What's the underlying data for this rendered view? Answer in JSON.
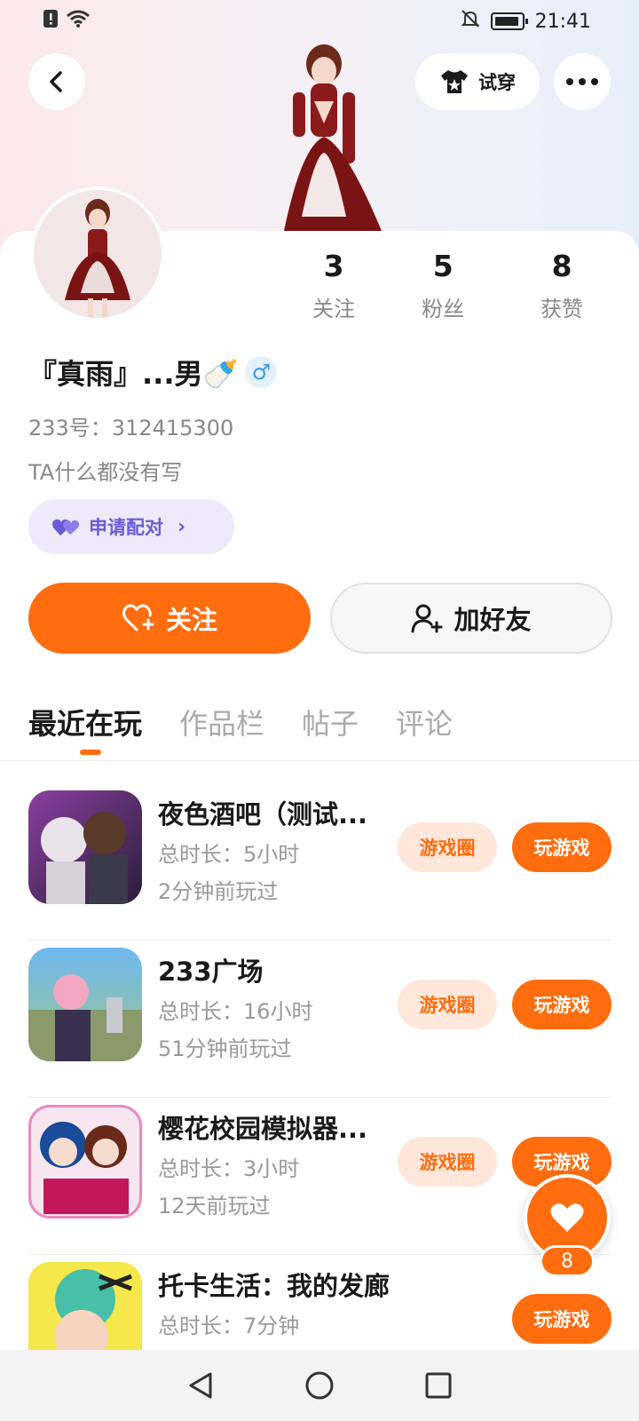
{
  "status_bar": {
    "time": "21:41"
  },
  "header": {
    "tryon_label": "试穿"
  },
  "stats": [
    {
      "value": "3",
      "label": "关注"
    },
    {
      "value": "5",
      "label": "粉丝"
    },
    {
      "value": "8",
      "label": "获赞"
    }
  ],
  "profile": {
    "name": "『真雨』...男🍼",
    "gender_symbol": "♂",
    "uid": "233号：312415300",
    "bio": "TA什么都没有写",
    "pair_label": "申请配对"
  },
  "actions": {
    "follow_label": "关注",
    "add_friend_label": "加好友"
  },
  "tabs": [
    "最近在玩",
    "作品栏",
    "帖子",
    "评论"
  ],
  "games": [
    {
      "title": "夜色酒吧（测试...",
      "duration": "总时长：5小时",
      "last_played": "2分钟前玩过",
      "circle_label": "游戏圈",
      "play_label": "玩游戏"
    },
    {
      "title": "233广场",
      "duration": "总时长：16小时",
      "last_played": "51分钟前玩过",
      "circle_label": "游戏圈",
      "play_label": "玩游戏"
    },
    {
      "title": "樱花校园模拟器...",
      "duration": "总时长：3小时",
      "last_played": "12天前玩过",
      "circle_label": "游戏圈",
      "play_label": "玩游戏"
    },
    {
      "title": "托卡生活：我的发廊",
      "duration": "总时长：7分钟",
      "last_played": "",
      "circle_label": "",
      "play_label": "玩游戏"
    }
  ],
  "like_float": {
    "count": "8"
  },
  "colors": {
    "accent": "#ff6d0e",
    "pair": "#6a5bd6"
  }
}
